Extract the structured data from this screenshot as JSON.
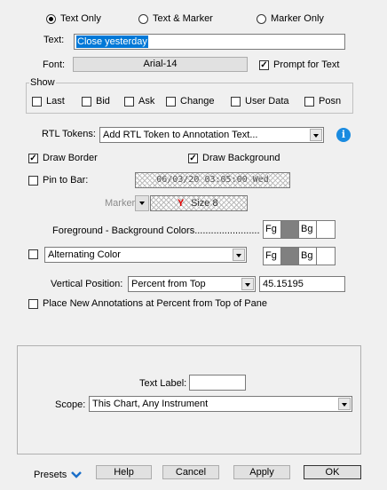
{
  "display_mode": {
    "text_only": "Text Only",
    "text_marker": "Text & Marker",
    "marker_only": "Marker Only"
  },
  "text": {
    "label": "Text:",
    "value": "Close yesterday"
  },
  "font": {
    "label": "Font:",
    "value": "Arial-14",
    "prompt_label": "Prompt for Text"
  },
  "show": {
    "title": "Show",
    "items": [
      "Last",
      "Bid",
      "Ask",
      "Change",
      "User Data",
      "Posn"
    ]
  },
  "rtl": {
    "label": "RTL Tokens:",
    "value": "Add RTL Token to Annotation Text..."
  },
  "draw_border": "Draw Border",
  "draw_background": "Draw Background",
  "pin_to_bar": {
    "label": "Pin to Bar:",
    "value": "06/03/20 03:05:00 Wed"
  },
  "marker": {
    "label": "Marker:",
    "size": "Size 8",
    "glyph": "Y"
  },
  "colors": {
    "label": "Foreground - Background Colors........................",
    "fg": "Fg",
    "bg": "Bg",
    "swatch_color": "#808080"
  },
  "alternating": {
    "value": "Alternating Color",
    "fg": "Fg",
    "bg": "Bg"
  },
  "vertical_position": {
    "label": "Vertical Position:",
    "mode": "Percent from Top",
    "value": "45.15195"
  },
  "place_new": "Place New Annotations at Percent from Top of Pane",
  "text_label": {
    "label": "Text Label:",
    "value": ""
  },
  "scope": {
    "label": "Scope:",
    "value": "This Chart, Any Instrument"
  },
  "footer": {
    "presets": "Presets",
    "help": "Help",
    "cancel": "Cancel",
    "apply": "Apply",
    "ok": "OK"
  },
  "accent": "#1a6fc9"
}
